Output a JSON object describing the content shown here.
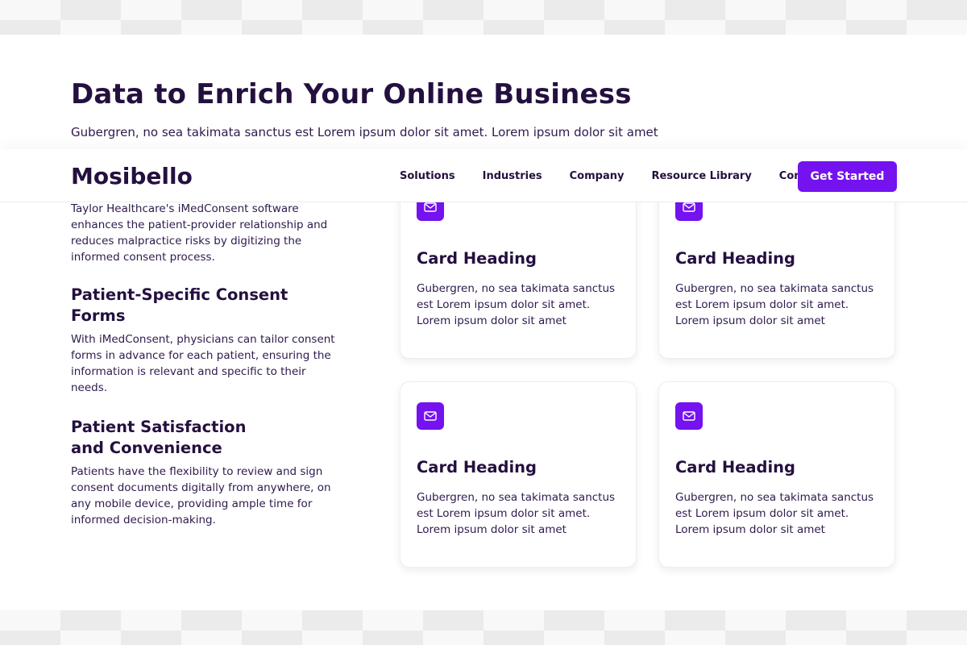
{
  "hero": {
    "title": "Data to Enrich Your Online Business",
    "subtitle": "Gubergren, no sea takimata sanctus est Lorem ipsum dolor sit amet. Lorem ipsum dolor sit amet"
  },
  "nav": {
    "logo": "Mosibello",
    "links": [
      "Solutions",
      "Industries",
      "Company",
      "Resource Library",
      "Contact"
    ],
    "cta": "Get Started"
  },
  "features": {
    "intro": "Taylor Healthcare's iMedConsent software enhances the patient-provider relationship and reduces malpractice risks by digitizing the informed consent process.",
    "items": [
      {
        "heading": "Patient-Specific Consent Forms",
        "text": "With iMedConsent, physicians can tailor consent forms in advance for each patient, ensuring the information is relevant and specific to their needs."
      },
      {
        "heading": "Patient Satisfaction and Convenience",
        "text": "Patients have the flexibility to review and sign consent documents digitally from anywhere, on any mobile device, providing ample time for informed decision-making."
      }
    ]
  },
  "cards": [
    {
      "icon": "mail-icon",
      "heading": "Card Heading",
      "text": "Gubergren, no sea takimata sanctus est Lorem ipsum dolor sit amet. Lorem ipsum dolor sit amet"
    },
    {
      "icon": "mail-icon",
      "heading": "Card Heading",
      "text": "Gubergren, no sea takimata sanctus est Lorem ipsum dolor sit amet. Lorem ipsum dolor sit amet"
    },
    {
      "icon": "mail-icon",
      "heading": "Card Heading",
      "text": "Gubergren, no sea takimata sanctus est Lorem ipsum dolor sit amet. Lorem ipsum dolor sit amet"
    },
    {
      "icon": "mail-icon",
      "heading": "Card Heading",
      "text": "Gubergren, no sea takimata sanctus est Lorem ipsum dolor sit amet. Lorem ipsum dolor sit amet"
    }
  ],
  "colors": {
    "accent": "#7412f0",
    "text_dark": "#24103f"
  }
}
